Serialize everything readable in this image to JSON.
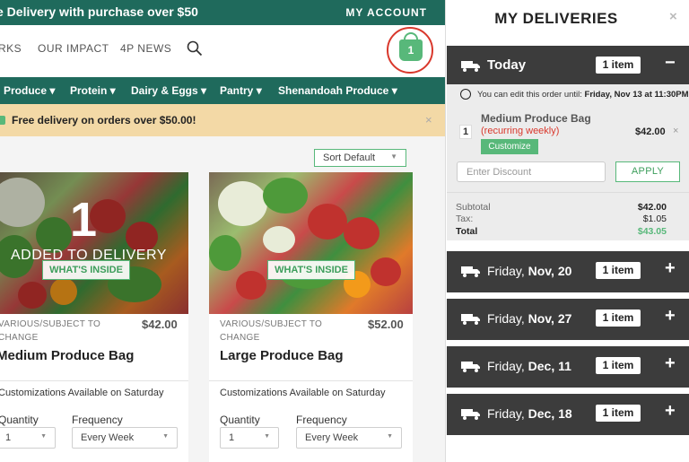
{
  "top_bar": {
    "promo": "e Delivery with purchase over $50",
    "account": "MY ACCOUNT"
  },
  "main_nav": {
    "items": [
      "RKS",
      "OUR IMPACT",
      "4P NEWS"
    ],
    "cart_count": "1"
  },
  "category_nav": [
    "Produce",
    "Protein",
    "Dairy & Eggs",
    "Pantry",
    "Shenandoah Produce"
  ],
  "banner": {
    "text": "Free delivery on orders over $50.00!",
    "close": "×"
  },
  "sort": {
    "label": "Sort Default"
  },
  "products": [
    {
      "added_count": "1",
      "added_text": "ADDED TO DELIVERY",
      "whats_inside": "WHAT'S INSIDE",
      "variety": "VARIOUS/SUBJECT TO CHANGE",
      "price": "$42.00",
      "name": "Medium Produce Bag",
      "customizations": "Customizations Available on Saturday",
      "quantity_label": "Quantity",
      "quantity_value": "1",
      "frequency_label": "Frequency",
      "frequency_value": "Every Week"
    },
    {
      "whats_inside": "WHAT'S INSIDE",
      "variety": "VARIOUS/SUBJECT TO CHANGE",
      "price": "$52.00",
      "name": "Large Produce Bag",
      "customizations": "Customizations Available on Saturday",
      "quantity_label": "Quantity",
      "quantity_value": "1",
      "frequency_label": "Frequency",
      "frequency_value": "Every Week"
    }
  ],
  "panel": {
    "title": "MY DELIVERIES",
    "close": "×",
    "today": {
      "label": "Today",
      "items": "1 item",
      "toggle": "−",
      "edit_prefix": "You can edit this order until:",
      "edit_until": "Friday, Nov 13 at 11:30PM",
      "item": {
        "qty": "1",
        "name": "Medium Produce Bag",
        "recurring": "(recurring weekly)",
        "price": "$42.00",
        "remove": "×",
        "customize": "Customize"
      },
      "discount_placeholder": "Enter Discount",
      "apply": "APPLY",
      "subtotal_label": "Subtotal",
      "subtotal": "$42.00",
      "tax_label": "Tax:",
      "tax": "$1.05",
      "total_label": "Total",
      "total": "$43.05"
    },
    "upcoming": [
      {
        "day": "Friday, ",
        "date": "Nov, 20",
        "items": "1 item",
        "toggle": "+"
      },
      {
        "day": "Friday, ",
        "date": "Nov, 27",
        "items": "1 item",
        "toggle": "+"
      },
      {
        "day": "Friday, ",
        "date": "Dec, 11",
        "items": "1 item",
        "toggle": "+"
      },
      {
        "day": "Friday, ",
        "date": "Dec, 18",
        "items": "1 item",
        "toggle": "+"
      }
    ]
  },
  "colors": {
    "brand_green": "#1f6a5c",
    "accent_green": "#58b87a",
    "alert_red": "#d9382c",
    "banner": "#f3d9a6",
    "dark_bar": "#3c3c3c"
  }
}
